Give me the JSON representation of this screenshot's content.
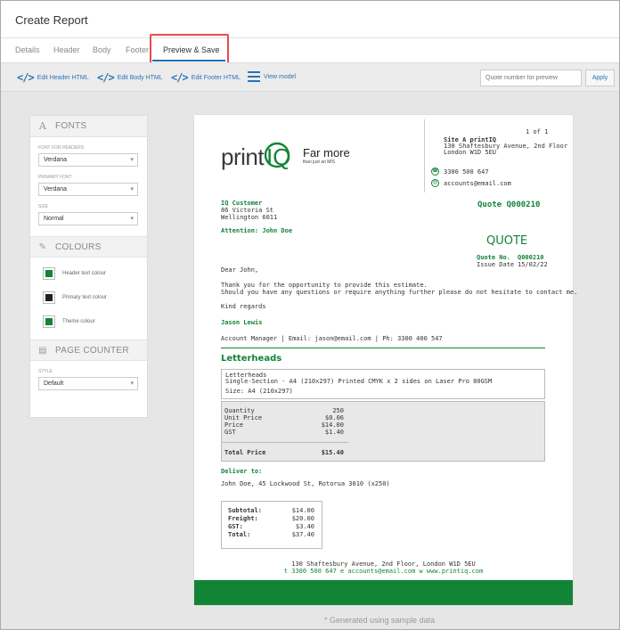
{
  "window": {
    "title": "Create Report"
  },
  "tabs": [
    {
      "label": "Details"
    },
    {
      "label": "Header"
    },
    {
      "label": "Body"
    },
    {
      "label": "Footer"
    },
    {
      "label": "Preview & Save",
      "active": true
    }
  ],
  "toolbar": {
    "edit_header": "Edit Header HTML",
    "edit_body": "Edit Body HTML",
    "edit_footer": "Edit Footer HTML",
    "view_model": "View model",
    "quote_placeholder": "Quote number for preview",
    "apply": "Apply"
  },
  "sidebar": {
    "fonts": {
      "heading": "FONTS",
      "font_for_headers_label": "FONT FOR HEADERS",
      "font_for_headers": "Verdana",
      "primary_font_label": "PRIMARY FONT",
      "primary_font": "Verdana",
      "size_label": "SIZE",
      "size": "Normal"
    },
    "colours": {
      "heading": "COLOURS",
      "items": [
        {
          "label": "Header text colour",
          "color": "#128436"
        },
        {
          "label": "Primary text colour",
          "color": "#222222"
        },
        {
          "label": "Theme colour",
          "color": "#128436"
        }
      ]
    },
    "page_counter": {
      "heading": "PAGE COUNTER",
      "style_label": "STYLE",
      "style": "Default"
    }
  },
  "document": {
    "logo_print": "print",
    "logo_iq": "IQ",
    "logo_tagline_1": "Far more",
    "logo_tagline_2": "than just an MIS",
    "page_no": "1 of 1",
    "site_name": "Site A printIQ",
    "site_addr_1": "130 Shaftesbury Avenue, 2nd Floor",
    "site_addr_2": "London W1D 5EU",
    "phone": "3300 500 647",
    "email": "accounts@email.com",
    "customer_name": "IQ Customer",
    "customer_addr_1": "86 Victoria St",
    "customer_addr_2": "Wellington 6011",
    "attention": "Attention: John Doe",
    "quote_id": "Quote Q000210",
    "doc_type": "QUOTE",
    "quote_no_label": "Quote No.",
    "quote_no": "Q000210",
    "issue_date_label": "Issue Date",
    "issue_date": "15/02/22",
    "greeting": "Dear John,",
    "thanks": "Thank you for the opportunity to provide this estimate.",
    "questions": "Should you have any questions or require anything further please do not hesitate to contact me.",
    "regards": "Kind regards",
    "sender_name": "Jason Lewis",
    "sender_info": "Account Manager | Email: jason@email.com | Ph: 3300 400 547",
    "product_heading": "Letterheads",
    "item_title": "Letterheads",
    "item_desc": "Single-Section - A4 (210x297) Printed CMYK x 2 sides on Laser Pro 80GSM",
    "item_size": "Size: A4 (210x297)",
    "pricing": [
      {
        "label": "Quantity",
        "value": "250"
      },
      {
        "label": "Unit Price",
        "value": "$0.06"
      },
      {
        "label": "Price",
        "value": "$14.00"
      },
      {
        "label": "GST",
        "value": "$1.40"
      }
    ],
    "total_price_label": "Total Price",
    "total_price": "$15.40",
    "deliver_to_label": "Deliver to:",
    "deliver_to": "John Doe, 45 Lockwood St, Rotorua 3010 (x250)",
    "totals": [
      {
        "label": "Subtotal:",
        "value": "$14.00"
      },
      {
        "label": "Freight:",
        "value": "$20.00"
      },
      {
        "label": "GST:",
        "value": "$3.40"
      },
      {
        "label": "Total:",
        "value": "$37.40"
      }
    ],
    "footer_addr": "130 Shaftesbury Avenue, 2nd Floor, London W1D 5EU",
    "footer_contact_t": "t",
    "footer_phone": "3300 500 647",
    "footer_contact_e": "e",
    "footer_email": "accounts@email.com",
    "footer_contact_w": "w",
    "footer_web": "www.printiq.com"
  },
  "sample_note": "* Generated using sample data"
}
